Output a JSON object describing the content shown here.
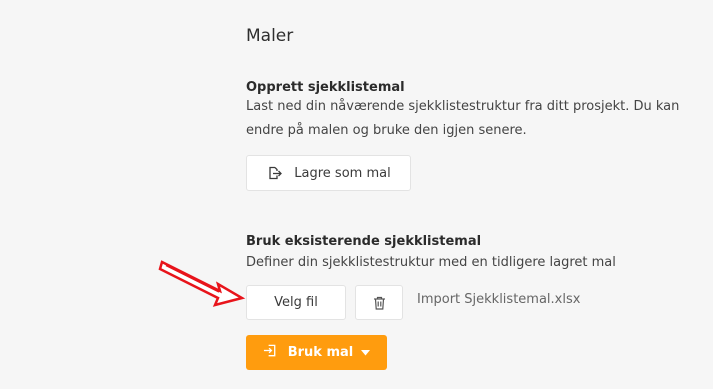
{
  "page": {
    "title": "Maler"
  },
  "create_template": {
    "heading": "Opprett sjekklistemal",
    "description": "Last ned din nåværende sjekklistestruktur fra ditt prosjekt. Du kan endre på malen og bruke den igjen senere.",
    "save_button_label": "Lagre som mal",
    "save_button_icon": "export-icon"
  },
  "use_template": {
    "heading": "Bruk eksisterende sjekklistemal",
    "description": "Definer din sjekklistestruktur med en tidligere lagret mal",
    "choose_file_label": "Velg fil",
    "delete_icon": "trash-icon",
    "file_name": "Import Sjekklistemal.xlsx",
    "apply_button_label": "Bruk mal",
    "apply_button_icon": "import-icon",
    "apply_button_color": "#ff9c0e"
  },
  "annotation": {
    "arrow_color": "#e8141b"
  }
}
